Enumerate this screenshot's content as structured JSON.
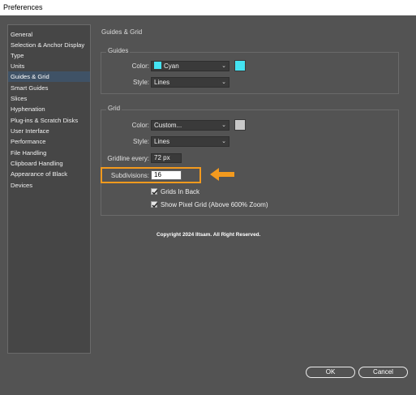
{
  "window": {
    "title": "Preferences"
  },
  "sidebar": {
    "items": [
      {
        "label": "General",
        "selected": false
      },
      {
        "label": "Selection & Anchor Display",
        "selected": false
      },
      {
        "label": "Type",
        "selected": false
      },
      {
        "label": "Units",
        "selected": false
      },
      {
        "label": "Guides & Grid",
        "selected": true
      },
      {
        "label": "Smart Guides",
        "selected": false
      },
      {
        "label": "Slices",
        "selected": false
      },
      {
        "label": "Hyphenation",
        "selected": false
      },
      {
        "label": "Plug-ins & Scratch Disks",
        "selected": false
      },
      {
        "label": "User Interface",
        "selected": false
      },
      {
        "label": "Performance",
        "selected": false
      },
      {
        "label": "File Handling",
        "selected": false
      },
      {
        "label": "Clipboard Handling",
        "selected": false
      },
      {
        "label": "Appearance of Black",
        "selected": false
      },
      {
        "label": "Devices",
        "selected": false
      }
    ]
  },
  "panel": {
    "title": "Guides & Grid"
  },
  "guides": {
    "group_label": "Guides",
    "color_label": "Color:",
    "color_value": "Cyan",
    "color_hex": "#44e3f2",
    "style_label": "Style:",
    "style_value": "Lines"
  },
  "grid": {
    "group_label": "Grid",
    "color_label": "Color:",
    "color_value": "Custom...",
    "color_hex": "#c8c8c8",
    "style_label": "Style:",
    "style_value": "Lines",
    "gridline_label": "Gridline every:",
    "gridline_value": "72 px",
    "subdivisions_label": "Subdivisions:",
    "subdivisions_value": "16",
    "grids_in_back_label": "Grids In Back",
    "grids_in_back_checked": true,
    "pixel_grid_label": "Show Pixel Grid (Above 600% Zoom)",
    "pixel_grid_checked": true
  },
  "copyright": "Copyright 2024 Iltsam. All Right Reserved.",
  "buttons": {
    "ok_label": "OK",
    "cancel_label": "Cancel"
  },
  "colors": {
    "highlight": "#f39a1e",
    "selection": "#3f5266"
  }
}
